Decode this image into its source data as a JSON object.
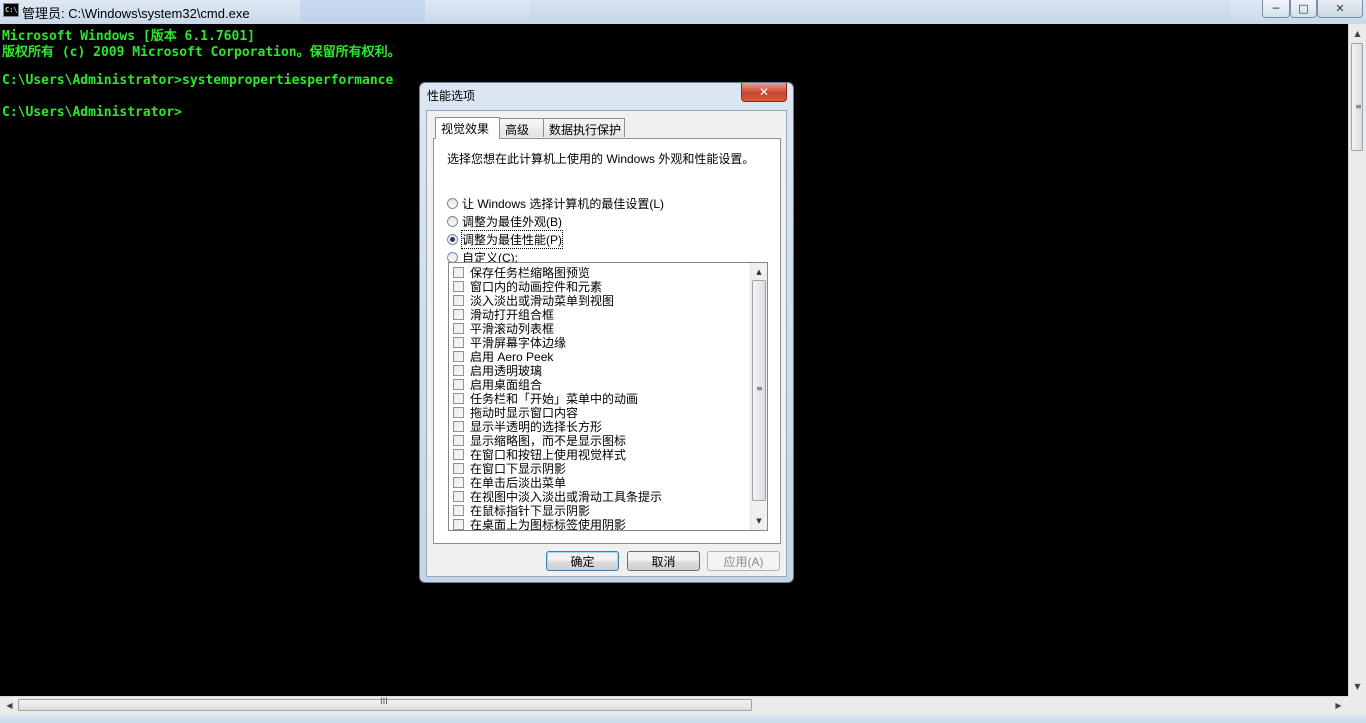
{
  "window": {
    "title": "管理员: C:\\Windows\\system32\\cmd.exe",
    "icon": "C:\\",
    "controls": {
      "minimize": "─",
      "maximize": "□",
      "close": "✕"
    }
  },
  "console": {
    "lines": [
      "Microsoft Windows [版本 6.1.7601]",
      "版权所有 (c) 2009 Microsoft Corporation。保留所有权利。",
      "",
      "C:\\Users\\Administrator>systempropertiesperformance",
      "",
      "C:\\Users\\Administrator>"
    ]
  },
  "scrollbars": {
    "up": "▲",
    "down": "▼",
    "left": "◀",
    "right": "▶",
    "grip_v": "≡",
    "grip_h": "III"
  },
  "dialog": {
    "title": "性能选项",
    "close": "✕",
    "tabs": [
      "视觉效果",
      "高级",
      "数据执行保护"
    ],
    "active_tab": 0,
    "description": "选择您想在此计算机上使用的 Windows 外观和性能设置。",
    "options": [
      "让 Windows 选择计算机的最佳设置(L)",
      "调整为最佳外观(B)",
      "调整为最佳性能(P)",
      "自定义(C):"
    ],
    "selected_option": 2,
    "effects": [
      "保存任务栏缩略图预览",
      "窗口内的动画控件和元素",
      "淡入淡出或滑动菜单到视图",
      "滑动打开组合框",
      "平滑滚动列表框",
      "平滑屏幕字体边缘",
      "启用 Aero Peek",
      "启用透明玻璃",
      "启用桌面组合",
      "任务栏和「开始」菜单中的动画",
      "拖动时显示窗口内容",
      "显示半透明的选择长方形",
      "显示缩略图，而不是显示图标",
      "在窗口和按钮上使用视觉样式",
      "在窗口下显示阴影",
      "在单击后淡出菜单",
      "在视图中淡入淡出或滑动工具条提示",
      "在鼠标指针下显示阴影",
      "在桌面上为图标标签使用阴影"
    ],
    "effects_checked": [
      false,
      false,
      false,
      false,
      false,
      false,
      false,
      false,
      false,
      false,
      false,
      false,
      false,
      false,
      false,
      false,
      false,
      false,
      false
    ],
    "buttons": {
      "ok": "确定",
      "cancel": "取消",
      "apply": "应用(A)"
    }
  },
  "colors": {
    "console_text": "#2ee62e",
    "console_bg": "#000000",
    "dialog_frame": "#c5d5e7",
    "close_red": "#c8442c"
  }
}
